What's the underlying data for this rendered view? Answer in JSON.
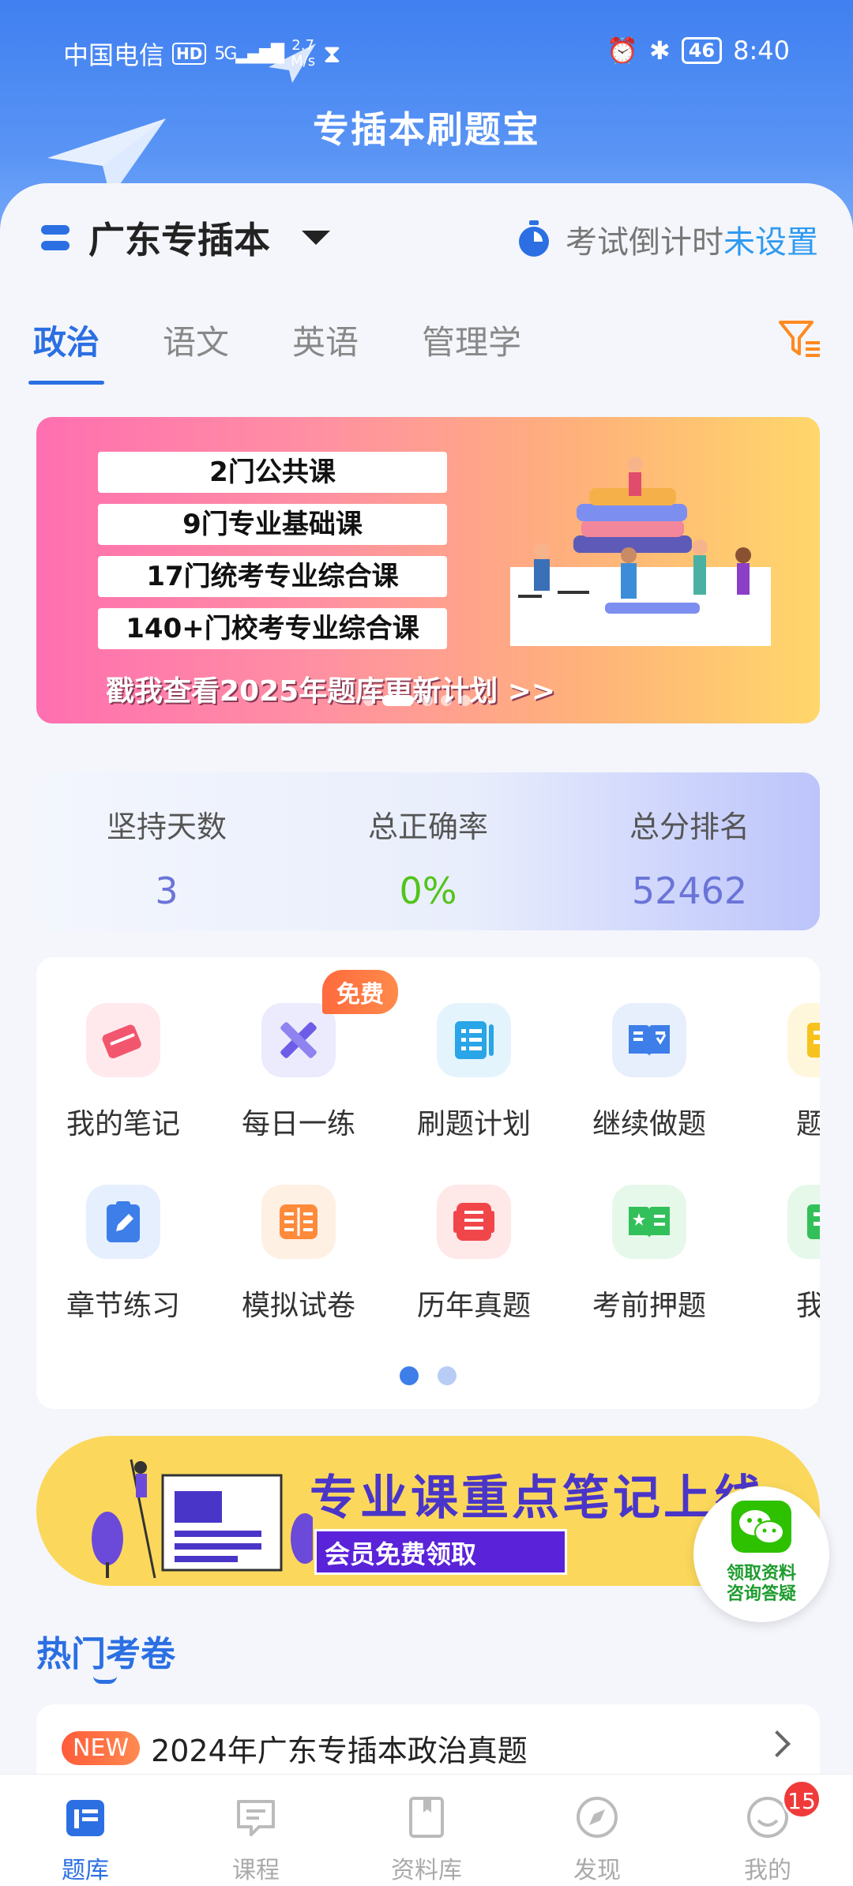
{
  "status_bar": {
    "carrier": "中国电信",
    "hd": "HD",
    "network": "5G",
    "speed_value": "2.7",
    "speed_unit": "M/s",
    "battery": "46",
    "time": "8:40"
  },
  "header": {
    "title": "专插本刷题宝"
  },
  "exam": {
    "name": "广东专插本",
    "countdown_label": "考试倒计时",
    "countdown_value": "未设置"
  },
  "subject_tabs": [
    "政治",
    "语文",
    "英语",
    "管理学"
  ],
  "active_subject_index": 0,
  "banner": {
    "pills": [
      "2门公共课",
      "9门专业基础课",
      "17门统考专业综合课",
      "140+门校考专业综合课"
    ],
    "cta": "戳我查看2025年题库更新计划 >>"
  },
  "stats": [
    {
      "label": "坚持天数",
      "value": "3",
      "color": "#6a74d8"
    },
    {
      "label": "总正确率",
      "value": "0%",
      "color": "#52c41a"
    },
    {
      "label": "总分排名",
      "value": "52462",
      "color": "#6a74d8"
    }
  ],
  "tools": [
    {
      "label": "我的笔记",
      "icon": "notebook-icon",
      "bg": "#ffe9ec",
      "fg": "#f2566e"
    },
    {
      "label": "每日一练",
      "icon": "pencil-ruler-icon",
      "bg": "#ecebfd",
      "fg": "#6c5ce7"
    },
    {
      "label": "刷题计划",
      "icon": "plan-list-icon",
      "bg": "#e4f4fd",
      "fg": "#2aa5e8"
    },
    {
      "label": "继续做题",
      "icon": "open-book-icon",
      "bg": "#e7effd",
      "fg": "#3d7ee8"
    },
    {
      "label": "题型",
      "icon": "question-type-icon",
      "bg": "#fff7dc",
      "fg": "#f7c21d"
    },
    {
      "label": "章节练习",
      "icon": "chapter-edit-icon",
      "bg": "#e6effd",
      "fg": "#3d7ee8"
    },
    {
      "label": "模拟试卷",
      "icon": "mock-paper-icon",
      "bg": "#fff0e4",
      "fg": "#ff8a3a"
    },
    {
      "label": "历年真题",
      "icon": "past-papers-icon",
      "bg": "#ffe8e8",
      "fg": "#f0464a"
    },
    {
      "label": "考前押题",
      "icon": "star-book-icon",
      "bg": "#e6f8ea",
      "fg": "#33c05a"
    },
    {
      "label": "我的",
      "icon": "my-item-icon",
      "bg": "#e6f8ea",
      "fg": "#33c05a"
    }
  ],
  "free_badge": "免费",
  "promo": {
    "title": "专业课重点笔记上线",
    "button": "会员免费领取"
  },
  "wechat_float": {
    "line1": "领取资料",
    "line2": "咨询答疑"
  },
  "hot_section": {
    "title": "热门考卷"
  },
  "papers": [
    {
      "badge": "NEW",
      "title": "2024年广东专插本政治真题"
    }
  ],
  "bottom_nav": [
    {
      "label": "题库",
      "icon": "question-bank-icon"
    },
    {
      "label": "课程",
      "icon": "course-icon"
    },
    {
      "label": "资料库",
      "icon": "library-icon"
    },
    {
      "label": "发现",
      "icon": "compass-icon"
    },
    {
      "label": "我的",
      "icon": "profile-icon"
    }
  ],
  "bottom_nav_badge": "15",
  "colors": {
    "primary": "#2b6fe3",
    "accent_link": "#2f9af0"
  }
}
